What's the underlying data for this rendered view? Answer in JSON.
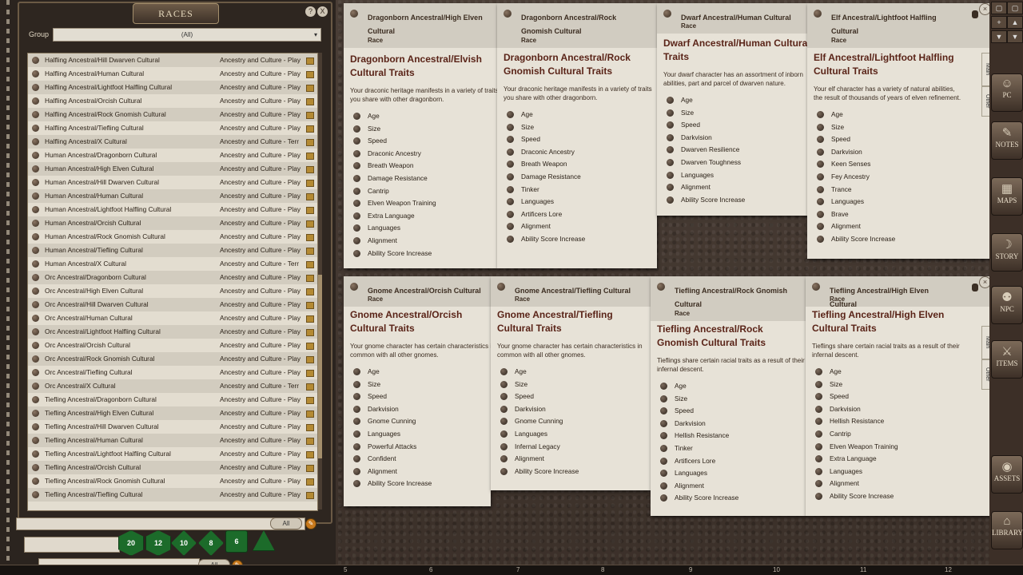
{
  "races_window": {
    "title": "RACES",
    "group_label": "Group",
    "group_value": "(All)",
    "help_glyph": "?",
    "close_glyph": "X",
    "items": [
      {
        "name": "Halfling Ancestral/Hill Dwarven Cultural",
        "category": "Ancestry and Culture - Play"
      },
      {
        "name": "Halfling Ancestral/Human Cultural",
        "category": "Ancestry and Culture - Play"
      },
      {
        "name": "Halfling Ancestral/Lightfoot Halfling Cultural",
        "category": "Ancestry and Culture - Play"
      },
      {
        "name": "Halfling Ancestral/Orcish Cultural",
        "category": "Ancestry and Culture - Play"
      },
      {
        "name": "Halfling Ancestral/Rock Gnomish Cultural",
        "category": "Ancestry and Culture - Play"
      },
      {
        "name": "Halfling Ancestral/Tiefling Cultural",
        "category": "Ancestry and Culture - Play"
      },
      {
        "name": "Halfling Ancestral/X Cultural",
        "category": "Ancestry and Culture - Terr"
      },
      {
        "name": "Human Ancestral/Dragonborn Cultural",
        "category": "Ancestry and Culture - Play"
      },
      {
        "name": "Human Ancestral/High Elven Cultural",
        "category": "Ancestry and Culture - Play"
      },
      {
        "name": "Human Ancestral/Hill Dwarven Cultural",
        "category": "Ancestry and Culture - Play"
      },
      {
        "name": "Human Ancestral/Human Cultural",
        "category": "Ancestry and Culture - Play"
      },
      {
        "name": "Human Ancestral/Lightfoot Halfling Cultural",
        "category": "Ancestry and Culture - Play"
      },
      {
        "name": "Human Ancestral/Orcish Cultural",
        "category": "Ancestry and Culture - Play"
      },
      {
        "name": "Human Ancestral/Rock Gnomish Cultural",
        "category": "Ancestry and Culture - Play"
      },
      {
        "name": "Human Ancestral/Tiefling Cultural",
        "category": "Ancestry and Culture - Play"
      },
      {
        "name": "Human Ancestral/X Cultural",
        "category": "Ancestry and Culture - Terr"
      },
      {
        "name": "Orc Ancestral/Dragonborn Cultural",
        "category": "Ancestry and Culture - Play"
      },
      {
        "name": "Orc Ancestral/High Elven Cultural",
        "category": "Ancestry and Culture - Play"
      },
      {
        "name": "Orc Ancestral/Hill Dwarven Cultural",
        "category": "Ancestry and Culture - Play"
      },
      {
        "name": "Orc Ancestral/Human Cultural",
        "category": "Ancestry and Culture - Play"
      },
      {
        "name": "Orc Ancestral/Lightfoot Halfling Cultural",
        "category": "Ancestry and Culture - Play"
      },
      {
        "name": "Orc Ancestral/Orcish Cultural",
        "category": "Ancestry and Culture - Play"
      },
      {
        "name": "Orc Ancestral/Rock Gnomish Cultural",
        "category": "Ancestry and Culture - Play"
      },
      {
        "name": "Orc Ancestral/Tiefling Cultural",
        "category": "Ancestry and Culture - Play"
      },
      {
        "name": "Orc Ancestral/X Cultural",
        "category": "Ancestry and Culture - Terr"
      },
      {
        "name": "Tiefling Ancestral/Dragonborn Cultural",
        "category": "Ancestry and Culture - Play"
      },
      {
        "name": "Tiefling Ancestral/High Elven Cultural",
        "category": "Ancestry and Culture - Play"
      },
      {
        "name": "Tiefling Ancestral/Hill Dwarven Cultural",
        "category": "Ancestry and Culture - Play"
      },
      {
        "name": "Tiefling Ancestral/Human Cultural",
        "category": "Ancestry and Culture - Play"
      },
      {
        "name": "Tiefling Ancestral/Lightfoot Halfling Cultural",
        "category": "Ancestry and Culture - Play"
      },
      {
        "name": "Tiefling Ancestral/Orcish Cultural",
        "category": "Ancestry and Culture - Play"
      },
      {
        "name": "Tiefling Ancestral/Rock Gnomish Cultural",
        "category": "Ancestry and Culture - Play"
      },
      {
        "name": "Tiefling Ancestral/Tiefling Cultural",
        "category": "Ancestry and Culture - Play"
      }
    ],
    "filter_button": "All"
  },
  "dice": [
    "20",
    "12",
    "10",
    "8",
    "6"
  ],
  "chat_filter_button": "All",
  "cards": [
    {
      "header": "Dragonborn Ancestral/High Elven Cultural",
      "type": "Race",
      "title": "Dragonborn Ancestral/Elvish Cultural Traits",
      "desc": "Your draconic heritage manifests in a variety of traits you share with other dragonborn.",
      "traits": [
        "Age",
        "Size",
        "Speed",
        "Draconic Ancestry",
        "Breath Weapon",
        "Damage Resistance",
        "Cantrip",
        "Elven Weapon Training",
        "Extra Language",
        "Languages",
        "Alignment",
        "Ability Score Increase"
      ]
    },
    {
      "header": "Dragonborn Ancestral/Rock Gnomish Cultural",
      "type": "Race",
      "title": "Dragonborn Ancestral/Rock Gnomish Cultural Traits",
      "desc": "Your draconic heritage manifests in a variety of traits you share with other dragonborn.",
      "traits": [
        "Age",
        "Size",
        "Speed",
        "Draconic Ancestry",
        "Breath Weapon",
        "Damage Resistance",
        "Tinker",
        "Languages",
        "Artificers Lore",
        "Alignment",
        "Ability Score Increase"
      ]
    },
    {
      "header": "Dwarf Ancestral/Human Cultural",
      "type": "Race",
      "title": "Dwarf Ancestral/Human Cultural Traits",
      "desc": "Your dwarf character has an assortment of inborn abilities, part and parcel of dwarven nature.",
      "traits": [
        "Age",
        "Size",
        "Speed",
        "Darkvision",
        "Dwarven Resilience",
        "Dwarven Toughness",
        "Languages",
        "Alignment",
        "Ability Score Increase"
      ]
    },
    {
      "header": "Elf Ancestral/Lightfoot Halfling Cultural",
      "type": "Race",
      "title": "Elf Ancestral/Lightfoot Halfling Cultural Traits",
      "desc": "Your elf character has a variety of natural abilities, the result of thousands of years of elven refinement.",
      "traits": [
        "Age",
        "Size",
        "Speed",
        "Darkvision",
        "Keen Senses",
        "Fey Ancestry",
        "Trance",
        "Languages",
        "Brave",
        "Alignment",
        "Ability Score Increase"
      ]
    },
    {
      "header": "Gnome Ancestral/Orcish Cultural",
      "type": "Race",
      "title": "Gnome Ancestral/Orcish Cultural Traits",
      "desc": "Your gnome character has certain characteristics in common with all other gnomes.",
      "traits": [
        "Age",
        "Size",
        "Speed",
        "Darkvision",
        "Gnome Cunning",
        "Languages",
        "Powerful Attacks",
        "Confident",
        "Alignment",
        "Ability Score Increase"
      ]
    },
    {
      "header": "Gnome Ancestral/Tiefling Cultural",
      "type": "Race",
      "title": "Gnome Ancestral/Tiefling Cultural Traits",
      "desc": "Your gnome character has certain characteristics in common with all other gnomes.",
      "traits": [
        "Age",
        "Size",
        "Speed",
        "Darkvision",
        "Gnome Cunning",
        "Languages",
        "Infernal Legacy",
        "Alignment",
        "Ability Score Increase"
      ]
    },
    {
      "header": "Tiefling Ancestral/Rock Gnomish Cultural",
      "type": "Race",
      "title": "Tiefling Ancestral/Rock Gnomish Cultural Traits",
      "desc": "Tieflings share certain racial traits as a result of their infernal descent.",
      "traits": [
        "Age",
        "Size",
        "Speed",
        "Darkvision",
        "Hellish Resistance",
        "Tinker",
        "Artificers Lore",
        "Languages",
        "Alignment",
        "Ability Score Increase"
      ]
    },
    {
      "header": "Tiefling Ancestral/High Elven Cultural",
      "type": "Race",
      "title": "Tiefling Ancestral/High Elven Cultural Traits",
      "desc": "Tieflings share certain racial traits as a result of their infernal descent.",
      "traits": [
        "Age",
        "Size",
        "Speed",
        "Darkvision",
        "Hellish Resistance",
        "Cantrip",
        "Elven Weapon Training",
        "Extra Language",
        "Languages",
        "Alignment",
        "Ability Score Increase"
      ]
    }
  ],
  "card_tabs": {
    "main": "Main",
    "other": "Other"
  },
  "sidebar": [
    "PC",
    "NOTES",
    "MAPS",
    "STORY",
    "NPC",
    "ITEMS",
    "ASSETS",
    "LIBRARY"
  ],
  "ruler": [
    "5",
    "6",
    "7",
    "8",
    "9",
    "10",
    "11",
    "12"
  ]
}
